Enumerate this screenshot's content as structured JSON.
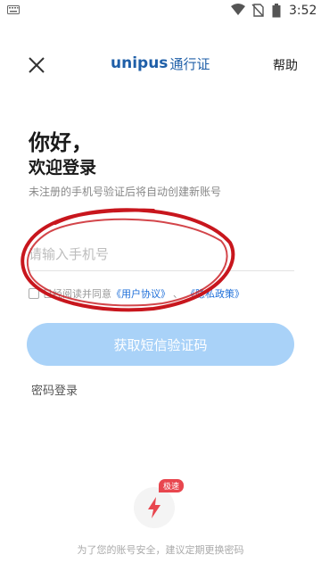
{
  "status_bar": {
    "time": "3:52",
    "icons": [
      "keyboard-icon",
      "wifi-icon",
      "no-sim-icon",
      "battery-icon"
    ]
  },
  "header": {
    "close_icon": "close-icon",
    "brand_latin": "unipus",
    "brand_cn": "通行证",
    "help_label": "帮助",
    "brand_color": "#1f5fa8"
  },
  "main": {
    "greeting": "你好，",
    "welcome": "欢迎登录",
    "notice": "未注册的手机号验证后将自动创建新账号",
    "phone_input": {
      "placeholder": "请输入手机号",
      "value": ""
    },
    "agreement": {
      "checked": false,
      "prefix": "已经阅读并同意",
      "user_agreement": "《用户协议》",
      "separator": "、",
      "privacy_policy": "《隐私政策》",
      "link_color": "#1e6fd9"
    },
    "sms_button_label": "获取短信验证码",
    "sms_button_color": "#a9d2f8",
    "password_login_label": "密码登录"
  },
  "footer": {
    "speed_tag": "极速",
    "speed_icon": "lightning-icon",
    "tip": "为了您的账号安全，建议定期更换密码",
    "accent_color": "#e8464e"
  },
  "annotation_color": "#c8161d"
}
